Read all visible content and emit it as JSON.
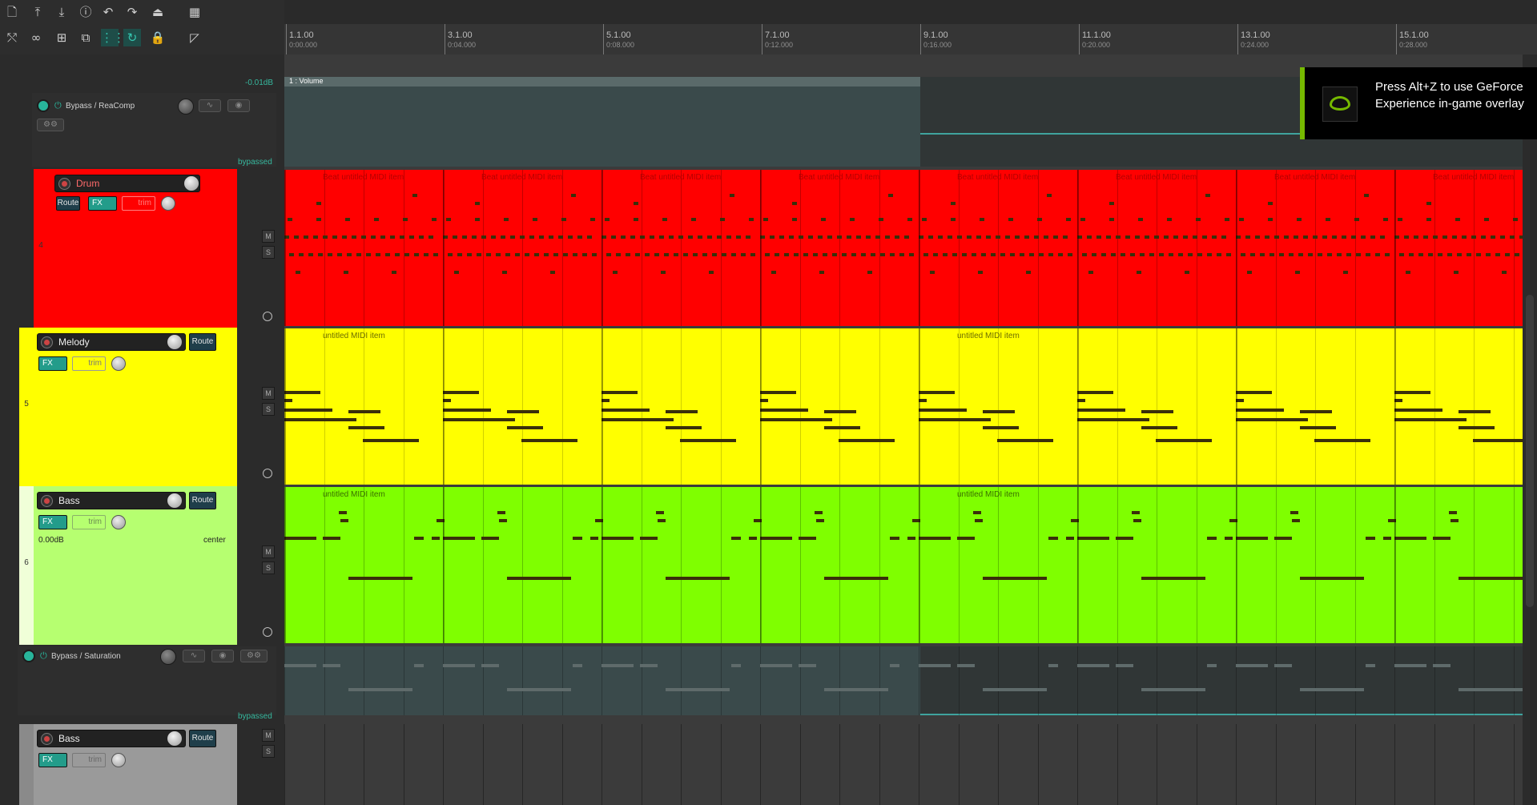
{
  "toolbar": {
    "row1": [
      "new-file-icon",
      "open-project-icon",
      "save-project-icon",
      "info-icon",
      "undo-icon",
      "redo-icon",
      "metronome-icon",
      "grid-icon"
    ],
    "row2": [
      "ripple-edit-icon",
      "link-icon",
      "snap-grid-icon",
      "group-icon",
      "grid-lines-icon",
      "loop-icon",
      "lock-icon",
      "trim-behind-icon"
    ]
  },
  "ruler": {
    "marks": [
      {
        "label": "1.1.00",
        "time": "0:00.000"
      },
      {
        "label": "3.1.00",
        "time": "0:04.000"
      },
      {
        "label": "5.1.00",
        "time": "0:08.000"
      },
      {
        "label": "7.1.00",
        "time": "0:12.000"
      },
      {
        "label": "9.1.00",
        "time": "0:16.000"
      },
      {
        "label": "11.1.00",
        "time": "0:20.000"
      },
      {
        "label": "13.1.00",
        "time": "0:24.000"
      },
      {
        "label": "15.1.00",
        "time": "0:28.000"
      }
    ]
  },
  "env_top": {
    "readout": "-0.01dB",
    "label": "Bypass / ReaComp",
    "status": "bypassed",
    "lane_label": "1 : Volume"
  },
  "env_bass": {
    "label": "Bypass / Saturation",
    "status": "bypassed"
  },
  "tracks": [
    {
      "num": "4",
      "name": "Drum",
      "route": "Route",
      "fx": "FX",
      "trim": "trim",
      "color": "#ff0000",
      "item": "Beat untitled MIDI item"
    },
    {
      "num": "5",
      "name": "Melody",
      "route": "Route",
      "fx": "FX",
      "trim": "trim",
      "color": "#ffff00",
      "item": "untitled MIDI item"
    },
    {
      "num": "6",
      "name": "Bass",
      "route": "Route",
      "fx": "FX",
      "trim": "trim",
      "vol": "0.00dB",
      "pan": "center",
      "color": "#7fff00",
      "item": "untitled MIDI item"
    },
    {
      "num": "",
      "name": "Bass",
      "route": "Route",
      "fx": "FX",
      "trim": "trim",
      "color": "#8a8a8a"
    }
  ],
  "ms": {
    "mute": "M",
    "solo": "S"
  },
  "overlay": {
    "text": "Press Alt+Z to use GeForce Experience in-game overlay",
    "icon": "nvidia-icon"
  },
  "colors": {
    "accent": "#36c6b0",
    "drum": "#ff0000",
    "melody": "#ffff00",
    "bass": "#7fff00"
  }
}
